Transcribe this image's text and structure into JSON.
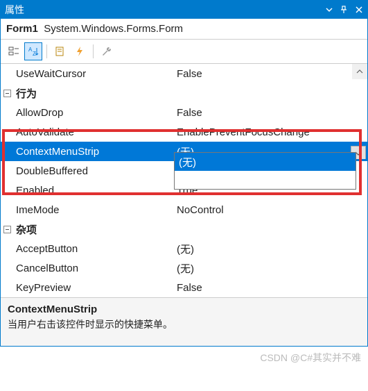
{
  "titlebar": {
    "title": "属性"
  },
  "object": {
    "name": "Form1",
    "type": "System.Windows.Forms.Form"
  },
  "toolbar": {
    "categorized": "categorized",
    "alphabetical": "alphabetical",
    "property_pages": "property-pages",
    "events": "events",
    "messages": "messages"
  },
  "rows": [
    {
      "kind": "prop",
      "name": "UseWaitCursor",
      "value": "False"
    },
    {
      "kind": "cat",
      "name": "行为"
    },
    {
      "kind": "prop",
      "name": "AllowDrop",
      "value": "False"
    },
    {
      "kind": "prop",
      "name": "AutoValidate",
      "value": "EnablePreventFocusChange"
    },
    {
      "kind": "prop",
      "name": "ContextMenuStrip",
      "value": "(无)",
      "selected": true,
      "hasdrop": true
    },
    {
      "kind": "prop",
      "name": "DoubleBuffered",
      "value": ""
    },
    {
      "kind": "prop",
      "name": "Enabled",
      "value": "True"
    },
    {
      "kind": "prop",
      "name": "ImeMode",
      "value": "NoControl"
    },
    {
      "kind": "cat",
      "name": "杂项"
    },
    {
      "kind": "prop",
      "name": "AcceptButton",
      "value": "(无)"
    },
    {
      "kind": "prop",
      "name": "CancelButton",
      "value": "(无)"
    },
    {
      "kind": "prop",
      "name": "KeyPreview",
      "value": "False"
    }
  ],
  "dropdown": {
    "items": [
      "(无)"
    ],
    "selectedIndex": 0
  },
  "description": {
    "title": "ContextMenuStrip",
    "text": "当用户右击该控件时显示的快捷菜单。"
  },
  "watermark": "CSDN @C#其实并不难"
}
